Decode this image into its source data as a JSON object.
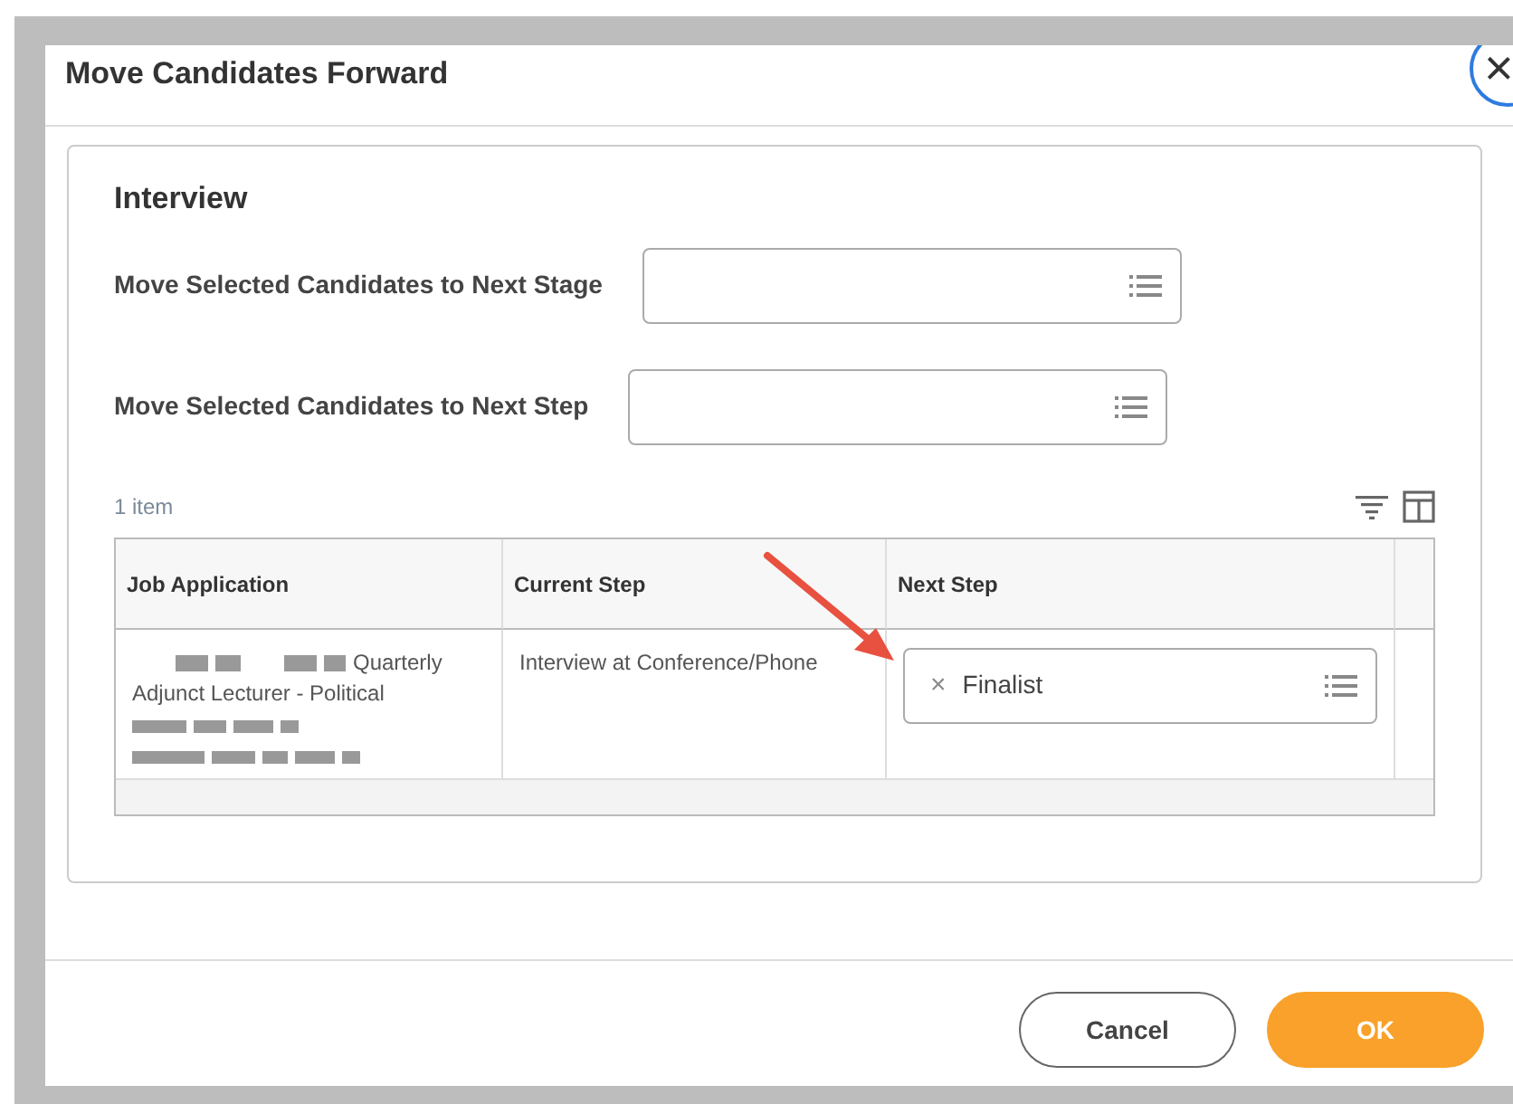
{
  "dialog": {
    "title": "Move Candidates Forward",
    "close": "×"
  },
  "section": {
    "title": "Interview",
    "fields": [
      {
        "label": "Move Selected Candidates to Next Stage"
      },
      {
        "label": "Move Selected Candidates to Next Step"
      }
    ]
  },
  "table": {
    "count": "1 item",
    "columns": [
      "Job Application",
      "Current Step",
      "Next Step"
    ],
    "rows": [
      {
        "job_application": {
          "line_1": "Quarterly",
          "line_2": "Adjunct Lecturer - Political"
        },
        "current_step": "Interview at Conference/Phone",
        "next_step": {
          "remove": "×",
          "value": "Finalist"
        }
      }
    ]
  },
  "buttons": [
    {
      "label": "Cancel",
      "kind": "secondary"
    },
    {
      "label": "OK",
      "kind": "primary"
    }
  ]
}
